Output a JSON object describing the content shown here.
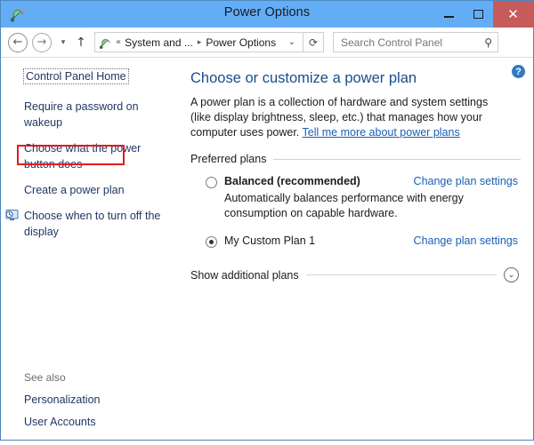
{
  "window": {
    "title": "Power Options",
    "icon": "power-plug-icon",
    "accent_titlebar": "#63adf7",
    "accent_close": "#c75b5b",
    "border_color": "#4a87bd",
    "controls": {
      "minimize_label": "Minimize",
      "maximize_label": "Maximize",
      "close_label": "Close"
    }
  },
  "nav": {
    "back_label": "Back",
    "forward_label": "Forward",
    "recent_label": "Recent locations",
    "up_label": "Up one level",
    "breadcrumb": {
      "overflow": "«",
      "segments": [
        "System and ...",
        "Power Options"
      ],
      "separator": "▸",
      "dropdown": "⌄",
      "icon": "power-plug-icon"
    },
    "refresh_label": "⟳"
  },
  "search": {
    "placeholder": "Search Control Panel",
    "value": "",
    "icon": "search-icon"
  },
  "sidebar": {
    "home": {
      "label": "Control Panel Home",
      "focused": true
    },
    "links": [
      {
        "label": "Require a password on wakeup",
        "icon": null,
        "highlighted": false
      },
      {
        "label": "Choose what the power button does",
        "icon": null,
        "highlighted": false
      },
      {
        "label": "Create a power plan",
        "icon": null,
        "highlighted": true
      },
      {
        "label": "Choose when to turn off the display",
        "icon": "display-clock-icon",
        "highlighted": false
      }
    ],
    "highlight_color": "#e21b1b",
    "see_also": {
      "title": "See also",
      "links": [
        "Personalization",
        "User Accounts"
      ]
    }
  },
  "main": {
    "help_icon_label": "?",
    "heading": "Choose or customize a power plan",
    "description_before": "A power plan is a collection of hardware and system settings (like display brightness, sleep, etc.) that manages how your computer uses power. ",
    "description_link": "Tell me more about power plans",
    "preferred_plans_label": "Preferred plans",
    "change_plan_label": "Change plan settings",
    "plans": [
      {
        "name": "Balanced (recommended)",
        "bold": true,
        "selected": false,
        "description": "Automatically balances performance with energy consumption on capable hardware.",
        "action": "Change plan settings"
      },
      {
        "name": "My Custom Plan 1",
        "bold": false,
        "selected": true,
        "description": "",
        "action": "Change plan settings"
      }
    ],
    "show_additional": {
      "label": "Show additional plans",
      "chevron": "⌄",
      "expanded": false
    }
  }
}
